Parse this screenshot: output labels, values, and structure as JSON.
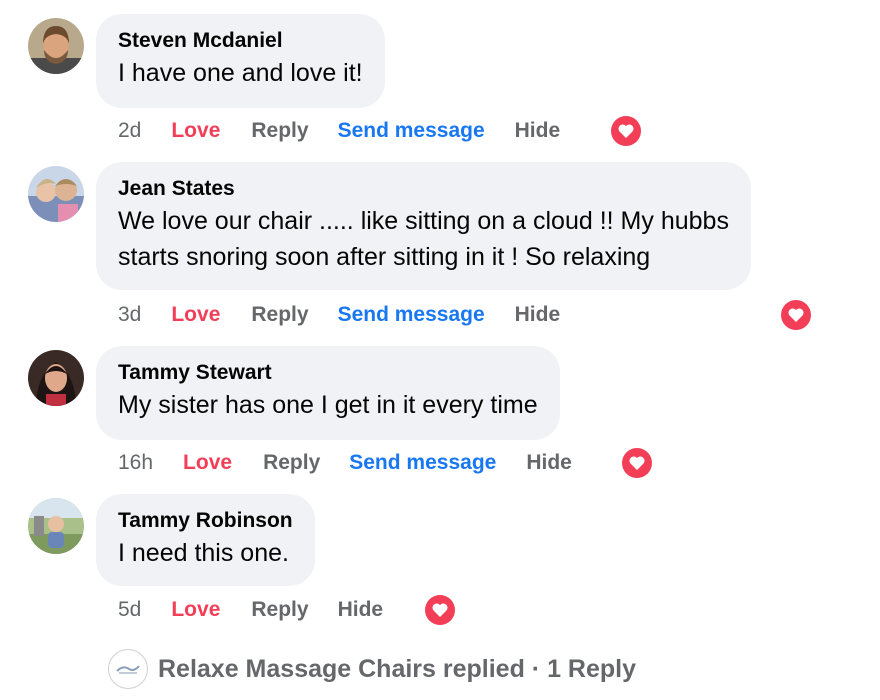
{
  "comments": [
    {
      "author": "Steven Mcdaniel",
      "text_lines": [
        "I have one and love it!"
      ],
      "time": "2d",
      "actions": {
        "love": "Love",
        "reply": "Reply",
        "send_message": "Send message",
        "hide": "Hide"
      },
      "reaction": "love"
    },
    {
      "author": "Jean States",
      "text_lines": [
        "We love our chair ..... like sitting on a cloud !! My hubbs",
        "starts snoring soon after sitting in it ! So relaxing"
      ],
      "time": "3d",
      "actions": {
        "love": "Love",
        "reply": "Reply",
        "send_message": "Send message",
        "hide": "Hide"
      },
      "reaction": "love"
    },
    {
      "author": "Tammy Stewart",
      "text_lines": [
        "My sister has one I get in it every time"
      ],
      "time": "16h",
      "actions": {
        "love": "Love",
        "reply": "Reply",
        "send_message": "Send message",
        "hide": "Hide"
      },
      "reaction": "love"
    },
    {
      "author": "Tammy Robinson",
      "text_lines": [
        "I need this one."
      ],
      "time": "5d",
      "actions": {
        "love": "Love",
        "reply": "Reply",
        "hide": "Hide"
      },
      "reaction": "love"
    }
  ],
  "replies_summary": {
    "text": "Relaxe Massage Chairs replied · 1 Reply"
  },
  "colors": {
    "love": "#f33e58",
    "link": "#1877f2",
    "muted": "#65676b",
    "bubble": "#f0f2f5"
  }
}
